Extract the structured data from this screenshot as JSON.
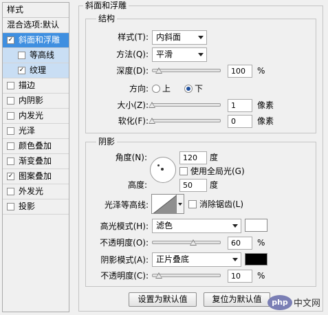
{
  "styles_panel": {
    "header": "样式",
    "items": [
      {
        "label": "混合选项:默认",
        "checkbox": false,
        "checked": false,
        "state": "normal"
      },
      {
        "label": "斜面和浮雕",
        "checkbox": true,
        "checked": true,
        "state": "selected"
      },
      {
        "label": "等高线",
        "checkbox": true,
        "checked": false,
        "state": "sub"
      },
      {
        "label": "纹理",
        "checkbox": true,
        "checked": true,
        "state": "sub"
      },
      {
        "label": "描边",
        "checkbox": true,
        "checked": false,
        "state": "normal"
      },
      {
        "label": "内阴影",
        "checkbox": true,
        "checked": false,
        "state": "normal"
      },
      {
        "label": "内发光",
        "checkbox": true,
        "checked": false,
        "state": "normal"
      },
      {
        "label": "光泽",
        "checkbox": true,
        "checked": false,
        "state": "normal"
      },
      {
        "label": "颜色叠加",
        "checkbox": true,
        "checked": false,
        "state": "normal"
      },
      {
        "label": "渐变叠加",
        "checkbox": true,
        "checked": false,
        "state": "normal"
      },
      {
        "label": "图案叠加",
        "checkbox": true,
        "checked": true,
        "state": "normal"
      },
      {
        "label": "外发光",
        "checkbox": true,
        "checked": false,
        "state": "normal"
      },
      {
        "label": "投影",
        "checkbox": true,
        "checked": false,
        "state": "normal"
      }
    ]
  },
  "bevel": {
    "title": "斜面和浮雕",
    "structure": {
      "title": "结构",
      "style_label": "样式(T):",
      "style_value": "内斜面",
      "technique_label": "方法(Q):",
      "technique_value": "平滑",
      "depth_label": "深度(D):",
      "depth_value": "100",
      "depth_unit": "%",
      "depth_slider_fraction": 0.1,
      "direction_label": "方向:",
      "direction_up": "上",
      "direction_down": "下",
      "direction_selected": "down",
      "size_label": "大小(Z):",
      "size_value": "1",
      "size_unit": "像素",
      "size_slider_fraction": 0.0,
      "soften_label": "软化(F):",
      "soften_value": "0",
      "soften_unit": "像素",
      "soften_slider_fraction": 0.0
    },
    "shading": {
      "title": "阴影",
      "angle_label": "角度(N):",
      "angle_value": "120",
      "angle_unit": "度",
      "global_light_label": "使用全局光(G)",
      "global_light_checked": false,
      "altitude_label": "高度:",
      "altitude_value": "50",
      "altitude_unit": "度",
      "gloss_contour_label": "光泽等高线:",
      "anti_alias_label": "消除锯齿(L)",
      "anti_alias_checked": false,
      "highlight_mode_label": "高光模式(H):",
      "highlight_mode_value": "滤色",
      "highlight_color": "#ffffff",
      "highlight_opacity_label": "不透明度(O):",
      "highlight_opacity_value": "60",
      "highlight_opacity_unit": "%",
      "highlight_opacity_fraction": 0.6,
      "shadow_mode_label": "阴影模式(A):",
      "shadow_mode_value": "正片叠底",
      "shadow_color": "#000000",
      "shadow_opacity_label": "不透明度(C):",
      "shadow_opacity_value": "10",
      "shadow_opacity_unit": "%",
      "shadow_opacity_fraction": 0.1
    },
    "buttons": {
      "make_default": "设置为默认值",
      "reset_default": "复位为默认值"
    }
  },
  "watermark": {
    "badge": "php",
    "text": "中文网"
  },
  "colors": {
    "selected_row": "#3f8fe0",
    "sub_row": "#c9def4",
    "background": "#f0f0f0"
  }
}
